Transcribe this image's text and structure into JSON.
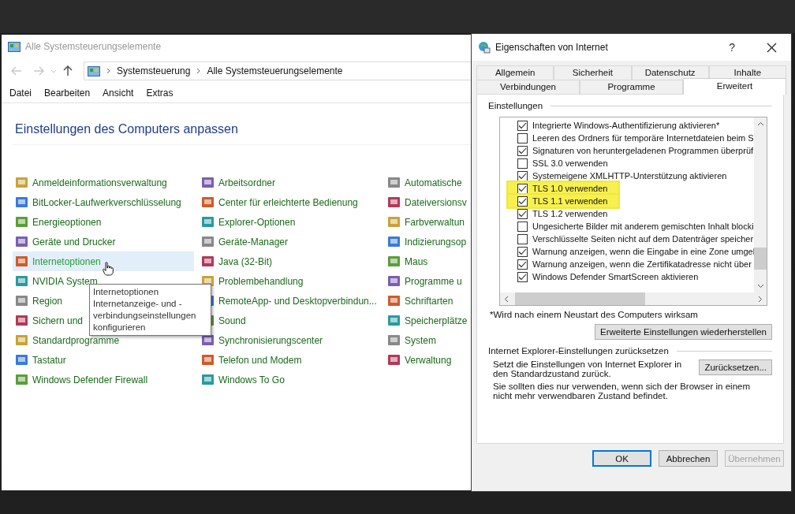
{
  "explorer": {
    "title": "Alle Systemsteuerungselemente",
    "breadcrumb": [
      "Systemsteuerung",
      "Alle Systemsteuerungselemente"
    ],
    "menu": [
      "Datei",
      "Bearbeiten",
      "Ansicht",
      "Extras"
    ],
    "heading": "Einstellungen des Computers anpassen",
    "columns": [
      [
        {
          "label": "Anmeldeinformationsverwaltung",
          "hovered": false
        },
        {
          "label": "BitLocker-Laufwerkverschlüsselung",
          "hovered": false
        },
        {
          "label": "Energieoptionen",
          "hovered": false
        },
        {
          "label": "Geräte und Drucker",
          "hovered": false
        },
        {
          "label": "Internetoptionen",
          "hovered": true
        },
        {
          "label": "NVIDIA System",
          "hovered": false
        },
        {
          "label": "Region",
          "hovered": false
        },
        {
          "label": "Sichern und",
          "hovered": false
        },
        {
          "label": "Standardprogramme",
          "hovered": false
        },
        {
          "label": "Tastatur",
          "hovered": false
        },
        {
          "label": "Windows Defender Firewall",
          "hovered": false
        }
      ],
      [
        {
          "label": "Arbeitsordner",
          "hovered": false
        },
        {
          "label": "Center für erleichterte Bedienung",
          "hovered": false
        },
        {
          "label": "Explorer-Optionen",
          "hovered": false
        },
        {
          "label": "Geräte-Manager",
          "hovered": false
        },
        {
          "label": "Java (32-Bit)",
          "hovered": false
        },
        {
          "label": "Problembehandlung",
          "hovered": false
        },
        {
          "label": "RemoteApp- und Desktopverbindun...",
          "hovered": false
        },
        {
          "label": "Sound",
          "hovered": false
        },
        {
          "label": "Synchronisierungscenter",
          "hovered": false
        },
        {
          "label": "Telefon und Modem",
          "hovered": false
        },
        {
          "label": "Windows To Go",
          "hovered": false
        }
      ],
      [
        {
          "label": "Automatische",
          "hovered": false
        },
        {
          "label": "Dateiversionsv",
          "hovered": false
        },
        {
          "label": "Farbverwaltun",
          "hovered": false
        },
        {
          "label": "Indizierungsop",
          "hovered": false
        },
        {
          "label": "Maus",
          "hovered": false
        },
        {
          "label": "Programme u",
          "hovered": false
        },
        {
          "label": "Schriftarten",
          "hovered": false
        },
        {
          "label": "Speicherplätze",
          "hovered": false
        },
        {
          "label": "System",
          "hovered": false
        },
        {
          "label": "Verwaltung",
          "hovered": false
        }
      ]
    ],
    "tooltip": [
      "Internetoptionen",
      "Internetanzeige- und -",
      "verbindungseinstellungen",
      "konfigurieren"
    ]
  },
  "dialog": {
    "title": "Eigenschaften von Internet",
    "help": "?",
    "tab_rows": [
      [
        {
          "label": "Allgemein",
          "selected": false
        },
        {
          "label": "Sicherheit",
          "selected": false
        },
        {
          "label": "Datenschutz",
          "selected": false
        },
        {
          "label": "Inhalte",
          "selected": false
        }
      ],
      [
        {
          "label": "Verbindungen",
          "selected": false
        },
        {
          "label": "Programme",
          "selected": false
        },
        {
          "label": "Erweitert",
          "selected": true
        }
      ]
    ],
    "settings_label": "Einstellungen",
    "settings": [
      {
        "label": "Integrierte Windows-Authentifizierung aktivieren*",
        "checked": true,
        "highlighted": false
      },
      {
        "label": "Leeren des Ordners für temporäre Internetdateien beim S",
        "checked": false,
        "highlighted": false
      },
      {
        "label": "Signaturen von heruntergeladenen Programmen überprüf",
        "checked": true,
        "highlighted": false
      },
      {
        "label": "SSL 3.0 verwenden",
        "checked": false,
        "highlighted": false
      },
      {
        "label": "Systemeigene XMLHTTP-Unterstützung aktivieren",
        "checked": true,
        "highlighted": false
      },
      {
        "label": "TLS 1.0 verwenden",
        "checked": true,
        "highlighted": true
      },
      {
        "label": "TLS 1.1 verwenden",
        "checked": true,
        "highlighted": true
      },
      {
        "label": "TLS 1.2 verwenden",
        "checked": true,
        "highlighted": false
      },
      {
        "label": "Ungesicherte Bilder mit anderem gemischten Inhalt blocki",
        "checked": false,
        "highlighted": false
      },
      {
        "label": "Verschlüsselte Seiten nicht auf dem Datenträger speicher",
        "checked": false,
        "highlighted": false
      },
      {
        "label": "Warnung anzeigen, wenn die Eingabe in eine Zone umgel",
        "checked": true,
        "highlighted": false
      },
      {
        "label": "Warnung anzeigen, wenn die Zertifikatadresse nicht über",
        "checked": true,
        "highlighted": false
      },
      {
        "label": "Windows Defender SmartScreen aktivieren",
        "checked": true,
        "highlighted": false
      }
    ],
    "note": "*Wird nach einem Neustart des Computers wirksam",
    "restore_button": "Erweiterte Einstellungen wiederherstellen",
    "reset_group": "Internet Explorer-Einstellungen zurücksetzen",
    "reset_text": "Setzt die Einstellungen von Internet Explorer in den Standardzustand zurück.",
    "reset_button": "Zurücksetzen...",
    "reset_warning": "Sie sollten dies nur verwenden, wenn sich der Browser in einem nicht mehr verwendbaren Zustand befindet.",
    "buttons": [
      {
        "label": "OK",
        "default": true,
        "disabled": false
      },
      {
        "label": "Abbrechen",
        "default": false,
        "disabled": false
      },
      {
        "label": "Übernehmen",
        "default": false,
        "disabled": true
      }
    ]
  }
}
